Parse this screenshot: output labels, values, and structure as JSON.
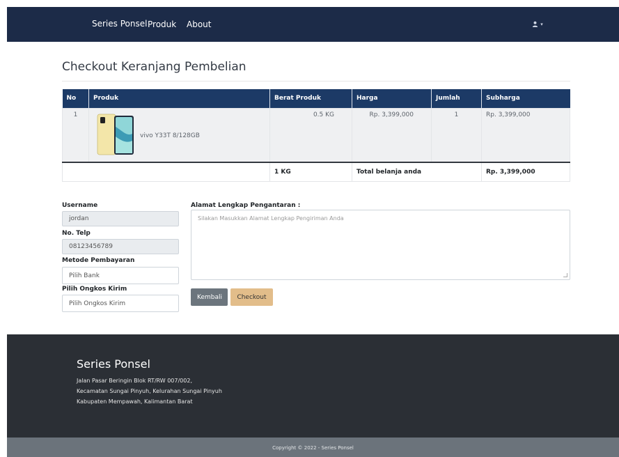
{
  "navbar": {
    "brand": "Series Ponsel",
    "links": [
      "Produk",
      "About"
    ],
    "user_caret": "▾"
  },
  "page": {
    "title": "Checkout Keranjang Pembelian"
  },
  "cart": {
    "headers": [
      "No",
      "Produk",
      "Berat Produk",
      "Harga",
      "Jumlah",
      "Subharga"
    ],
    "rows": [
      {
        "no": "1",
        "product": "vivo Y33T 8/128GB",
        "weight": "0.5 KG",
        "price": "Rp. 3,399,000",
        "qty": "1",
        "subtotal": "Rp. 3,399,000"
      }
    ],
    "total": {
      "weight": "1 KG",
      "label": "Total belanja anda",
      "amount": "Rp. 3,399,000"
    }
  },
  "form": {
    "username_label": "Username",
    "username_value": "jordan",
    "phone_label": "No. Telp",
    "phone_value": "08123456789",
    "payment_label": "Metode Pembayaran",
    "payment_value": "Pilih Bank",
    "shipping_label": "Pilih Ongkos Kirim",
    "shipping_value": "Pilih Ongkos Kirim",
    "address_label": "Alamat Lengkap Pengantaran :",
    "address_placeholder": "Silakan Masukkan Alamat Lengkap Pengiriman Anda",
    "back_button": "Kembali",
    "checkout_button": "Checkout"
  },
  "footer": {
    "title": "Series Ponsel",
    "address_lines": [
      "Jalan Pasar Beringin Blok RT/RW 007/002,",
      "Kecamatan Sungai Pinyuh, Kelurahan Sungai Pinyuh",
      "Kabupaten Mempawah, Kalimantan Barat"
    ],
    "copyright": "Copyright © 2022 - Series Ponsel"
  },
  "colors": {
    "navbar": "#1c2b48",
    "table_header": "#1c3a66",
    "checkout_button": "#e2bd8a",
    "back_button": "#6c757d",
    "footer": "#2b2f35",
    "copyright_bar": "#6b737b"
  },
  "icons": {
    "user": "user-icon",
    "product_image": "phone-image"
  }
}
